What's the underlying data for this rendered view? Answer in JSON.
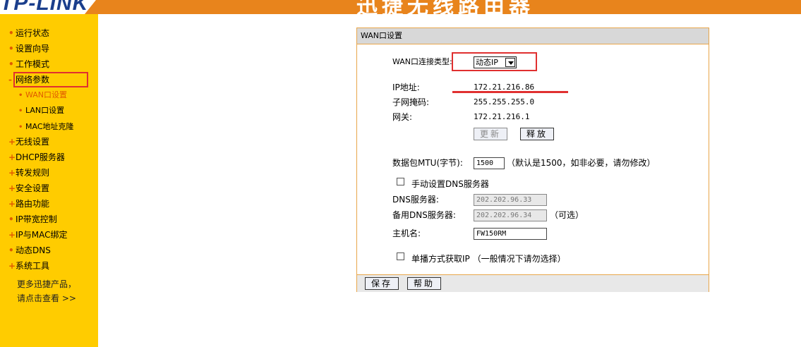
{
  "header": {
    "logo_text": "TP-LINK",
    "title": "迅捷无线路由器"
  },
  "sidebar": {
    "items": [
      {
        "marker": "•",
        "label": "运行状态"
      },
      {
        "marker": "•",
        "label": "设置向导"
      },
      {
        "marker": "•",
        "label": "工作模式"
      },
      {
        "marker": "-",
        "label": "网络参数"
      },
      {
        "marker": "•",
        "label": "WAN口设置"
      },
      {
        "marker": "•",
        "label": "LAN口设置"
      },
      {
        "marker": "•",
        "label": "MAC地址克隆"
      },
      {
        "marker": "+",
        "label": "无线设置"
      },
      {
        "marker": "+",
        "label": "DHCP服务器"
      },
      {
        "marker": "+",
        "label": "转发规则"
      },
      {
        "marker": "+",
        "label": "安全设置"
      },
      {
        "marker": "+",
        "label": "路由功能"
      },
      {
        "marker": "•",
        "label": "IP带宽控制"
      },
      {
        "marker": "+",
        "label": "IP与MAC绑定"
      },
      {
        "marker": "•",
        "label": "动态DNS"
      },
      {
        "marker": "+",
        "label": "系统工具"
      }
    ],
    "more_line1": "更多迅捷产品，",
    "more_line2": "请点击查看 >>"
  },
  "panel": {
    "title": "WAN口设置",
    "conn_type_label": "WAN口连接类型:",
    "conn_type_value": "动态IP",
    "ip_label": "IP地址:",
    "ip_value": "172.21.216.86",
    "mask_label": "子网掩码:",
    "mask_value": "255.255.255.0",
    "gateway_label": "网关:",
    "gateway_value": "172.21.216.1",
    "renew_button": "更新",
    "release_button": "释放",
    "mtu_label": "数据包MTU(字节):",
    "mtu_value": "1500",
    "mtu_hint": "（默认是1500，如非必要，请勿修改）",
    "manual_dns_label": "手动设置DNS服务器",
    "dns_label": "DNS服务器:",
    "dns_value": "202.202.96.33",
    "alt_dns_label": "备用DNS服务器:",
    "alt_dns_value": "202.202.96.34",
    "alt_dns_hint": "（可选）",
    "hostname_label": "主机名:",
    "hostname_value": "FW150RM",
    "unicast_label": "单播方式获取IP （一般情况下请勿选择）",
    "save_button": "保存",
    "help_button": "帮助"
  },
  "colors": {
    "header_orange": "#e8841c",
    "sidebar_yellow": "#ffcc00",
    "highlight_red": "#e03030"
  }
}
